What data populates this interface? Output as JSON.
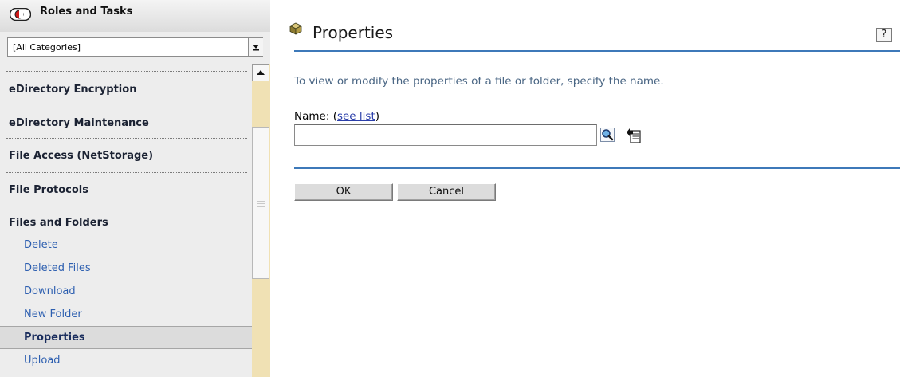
{
  "sidebar": {
    "title": "Roles and Tasks",
    "category_select": {
      "value": "[All Categories]"
    },
    "categories": [
      {
        "label": "eDirectory Encryption"
      },
      {
        "label": "eDirectory Maintenance"
      },
      {
        "label": "File Access (NetStorage)"
      },
      {
        "label": "File Protocols"
      },
      {
        "label": "Files and Folders"
      }
    ],
    "tasks": [
      {
        "label": "Delete",
        "selected": false
      },
      {
        "label": "Deleted Files",
        "selected": false
      },
      {
        "label": "Download",
        "selected": false
      },
      {
        "label": "New Folder",
        "selected": false
      },
      {
        "label": "Properties",
        "selected": true
      },
      {
        "label": "Upload",
        "selected": false
      }
    ]
  },
  "main": {
    "title": "Properties",
    "help_label": "?",
    "instructions": "To view or modify the properties of a file or folder, specify the name.",
    "name_label": "Name:",
    "name_link_open": "(",
    "name_link": "see list",
    "name_link_close": ")",
    "name_value": "",
    "ok_label": "OK",
    "cancel_label": "Cancel"
  },
  "colors": {
    "accent_rule": "#3d79b9",
    "link": "#2b3faa",
    "task_text": "#2d5fb0",
    "scroll_track": "#f0e1b4"
  },
  "icons": {
    "roles": "roles-and-tasks-icon",
    "page": "cube-icon",
    "search": "magnifier-icon",
    "browse": "object-browser-icon",
    "help": "help-icon"
  }
}
